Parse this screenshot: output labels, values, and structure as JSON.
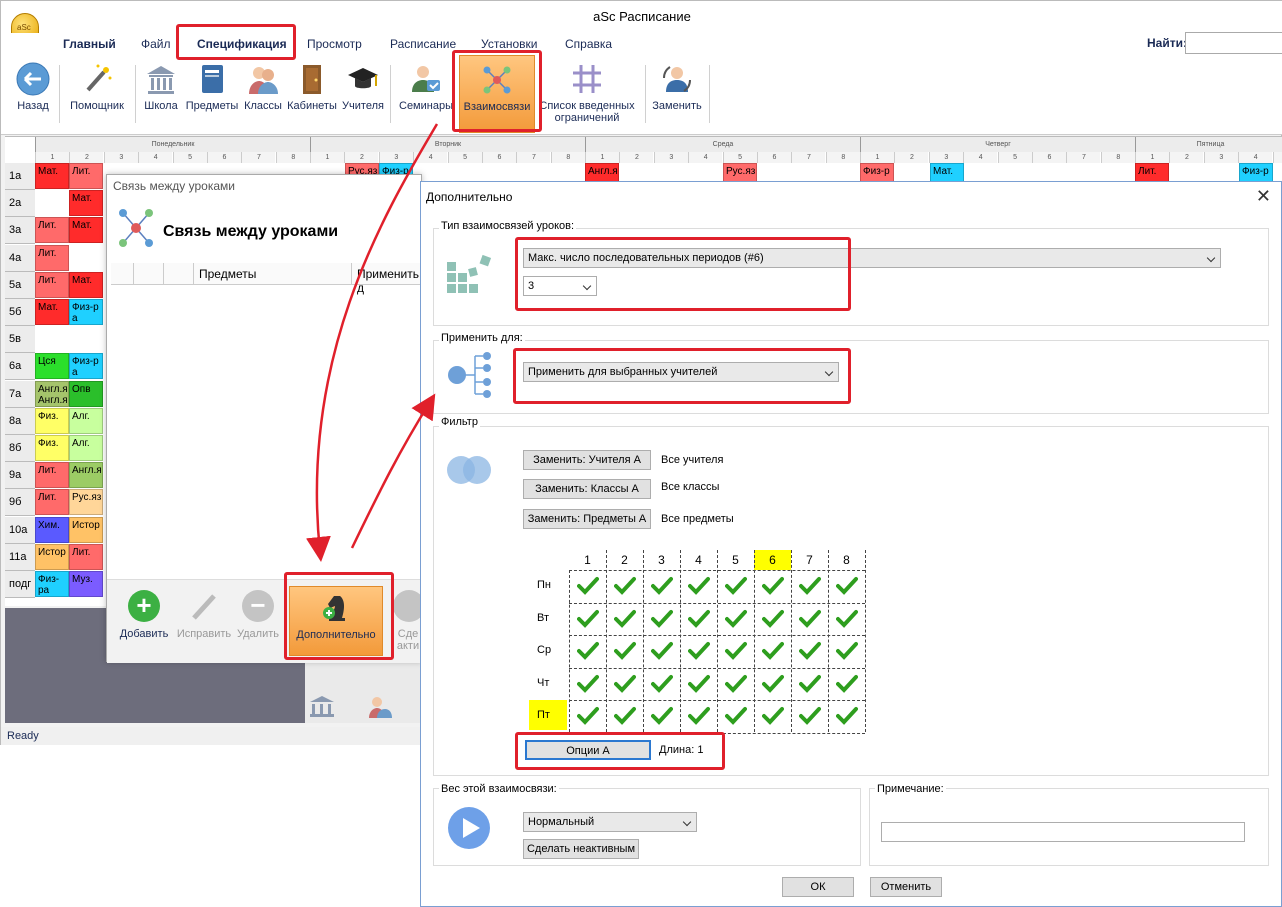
{
  "window": {
    "title": "aSc Расписание",
    "logo_text": "aSc"
  },
  "menu": {
    "items": [
      "Главный",
      "Файл",
      "Спецификация",
      "Просмотр",
      "Расписание",
      "Установки",
      "Справка"
    ],
    "find_label": "Найти:"
  },
  "ribbon": {
    "buttons": [
      "Назад",
      "Помощник",
      "Школа",
      "Предметы",
      "Классы",
      "Кабинеты",
      "Учителя",
      "Семинары",
      "Взаимосвязи",
      "Список введенных ограничений",
      "Заменить"
    ]
  },
  "grid": {
    "days": [
      "Понедельник",
      "Вторник",
      "Среда",
      "Четверг",
      "Пятница"
    ],
    "periods": [
      "1",
      "2",
      "3",
      "4",
      "5",
      "6",
      "7",
      "8"
    ],
    "classes": [
      "1а",
      "2а",
      "3а",
      "4а",
      "5а",
      "5б",
      "5в",
      "6а",
      "7а",
      "8а",
      "8б",
      "9а",
      "9б",
      "10а",
      "11а",
      "подг"
    ],
    "monday_col1": [
      "Мат.",
      "",
      "Лит.",
      "Лит.",
      "Лит.",
      "Мат.",
      "",
      "Цся",
      "Англ.я Англ.я",
      "Физ.",
      "Физ.",
      "Лит.",
      "Лит.",
      "Хим.",
      "Истор",
      "Физ-ра"
    ],
    "monday_col2": [
      "Лит.",
      "Мат.",
      "Мат.",
      "",
      "Мат.",
      "Физ-р а",
      "",
      "Физ-р а",
      "Опв",
      "Алг.",
      "Алг.",
      "Англ.я",
      "Рус.яз",
      "Истор",
      "Лит.",
      "Муз."
    ],
    "top_row_other": [
      "Рус.яз",
      "Физ-р",
      "Англ.я",
      "Рус.яз",
      "Физ-р",
      "Мат.",
      "Лит.",
      "Физ-р"
    ]
  },
  "status": {
    "text": "Ready"
  },
  "links_dialog": {
    "title": "Связь между уроками",
    "heading": "Связь между уроками",
    "columns": [
      "Предметы",
      "Применить д"
    ],
    "buttons": [
      "Добавить",
      "Исправить",
      "Удалить",
      "Дополнительно",
      "Сде",
      "акти"
    ]
  },
  "dialog": {
    "title": "Дополнительно",
    "close": "✕",
    "type_group": {
      "label": "Тип взаимосвязей уроков:",
      "selected": "Макс. число последовательных периодов (#6)",
      "count": "3"
    },
    "apply_group": {
      "label": "Применить для:",
      "selected": "Применить для выбранных учителей"
    },
    "filter_group": {
      "label": "Фильтр",
      "rows": [
        {
          "button": "Заменить: Учителя А",
          "value": "Все учителя"
        },
        {
          "button": "Заменить: Классы А",
          "value": "Все классы"
        },
        {
          "button": "Заменить: Предметы А",
          "value": "Все предметы"
        }
      ],
      "columns": [
        "1",
        "2",
        "3",
        "4",
        "5",
        "6",
        "7",
        "8"
      ],
      "highlighted_column": "6",
      "rows_days": [
        "Пн",
        "Вт",
        "Ср",
        "Чт",
        "Пт"
      ],
      "highlighted_row": "Пт",
      "all_checked": true,
      "options_button": "Опции А",
      "length_label": "Длина: 1"
    },
    "weight_group": {
      "label": "Вес этой взаимосвязи:",
      "selected": "Нормальный",
      "inactive_button": "Сделать неактивным"
    },
    "note_group": {
      "label": "Примечание:",
      "value": ""
    },
    "ok": "ОК",
    "cancel": "Отменить"
  },
  "colors": {
    "accent_red": "#e0202b",
    "check_green": "#2e9e1e",
    "highlight_yellow": "#ffff00",
    "active_orange": "#f7a54a"
  }
}
